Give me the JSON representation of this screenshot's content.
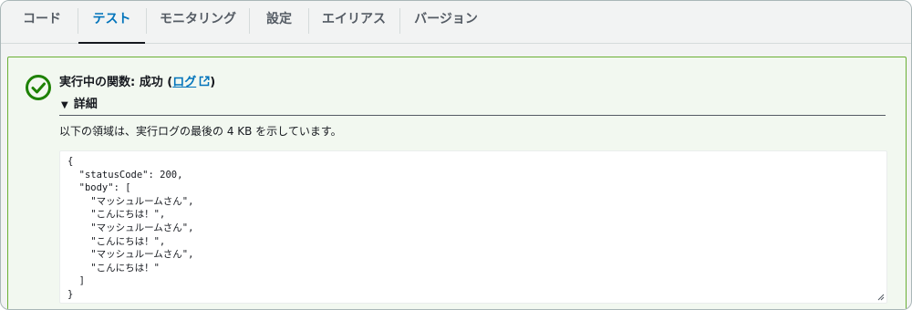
{
  "tabs": [
    {
      "label": "コード"
    },
    {
      "label": "テスト"
    },
    {
      "label": "モニタリング"
    },
    {
      "label": "設定"
    },
    {
      "label": "エイリアス"
    },
    {
      "label": "バージョン"
    }
  ],
  "active_tab": "テスト",
  "result": {
    "status_prefix": "実行中の関数: 成功 (",
    "log_link": "ログ",
    "status_suffix": ")",
    "details_label": "詳細",
    "description": "以下の領域は、実行ログの最後の 4 KB を示しています。",
    "output": "{\n  \"statusCode\": 200,\n  \"body\": [\n    \"マッシュルームさん\",\n    \"こんにちは！\",\n    \"マッシュルームさん\",\n    \"こんにちは！\",\n    \"マッシュルームさん\",\n    \"こんにちは！\"\n  ]\n}"
  },
  "colors": {
    "success": "#1d8102",
    "link": "#0073bb",
    "panel_border": "#6aaf35"
  },
  "icons": {
    "status": "check-circle-icon",
    "external": "external-link-icon",
    "details": "caret-down-icon",
    "resize": "resize-handle-icon"
  }
}
